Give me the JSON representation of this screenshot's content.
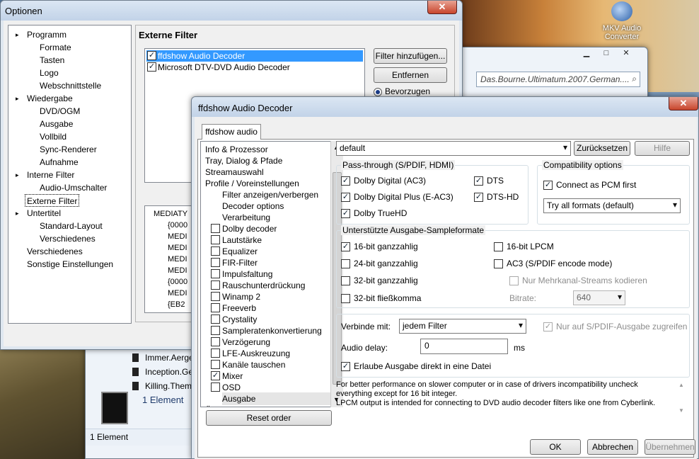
{
  "desktop": {
    "icon_label": "MKV Audio Converter"
  },
  "explorer": {
    "search_text": "Das.Bourne.Ultimatum.2007.German....",
    "files": [
      "Immer.Aerge",
      "Inception.Ge",
      "Killing.Them"
    ],
    "element_count": "1 Element",
    "status": "1 Element"
  },
  "optionen": {
    "title": "Optionen",
    "tree": [
      {
        "label": "Programm",
        "level": 0
      },
      {
        "label": "Formate",
        "level": 1
      },
      {
        "label": "Tasten",
        "level": 1
      },
      {
        "label": "Logo",
        "level": 1
      },
      {
        "label": "Webschnittstelle",
        "level": 1
      },
      {
        "label": "Wiedergabe",
        "level": 0
      },
      {
        "label": "DVD/OGM",
        "level": 1
      },
      {
        "label": "Ausgabe",
        "level": 1
      },
      {
        "label": "Vollbild",
        "level": 1
      },
      {
        "label": "Sync-Renderer",
        "level": 1
      },
      {
        "label": "Aufnahme",
        "level": 1
      },
      {
        "label": "Interne Filter",
        "level": 0
      },
      {
        "label": "Audio-Umschalter",
        "level": 1
      },
      {
        "label": "Externe Filter",
        "level": 0
      },
      {
        "label": "Untertitel",
        "level": 0
      },
      {
        "label": "Standard-Layout",
        "level": 1
      },
      {
        "label": "Verschiedenes",
        "level": 1
      },
      {
        "label": "Verschiedenes",
        "level": 0
      },
      {
        "label": "Sonstige Einstellungen",
        "level": 0
      }
    ],
    "panel_title": "Externe Filter",
    "filters": [
      "ffdshow Audio Decoder",
      "Microsoft DTV-DVD Audio Decoder"
    ],
    "add_button": "Filter hinzufügen...",
    "remove_button": "Entfernen",
    "prefer_label": "Bevorzugen",
    "second_tree": [
      "MEDIATY",
      "{0000",
      "MEDI",
      "MEDI",
      "MEDI",
      "MEDI",
      "{0000",
      "MEDI",
      "{EB2"
    ]
  },
  "ffdshow": {
    "title": "ffdshow Audio Decoder",
    "tab": "ffdshow audio",
    "left_items": [
      {
        "label": "Info & Prozessor",
        "indent": 0,
        "check": null
      },
      {
        "label": "Tray, Dialog & Pfade",
        "indent": 0,
        "check": null
      },
      {
        "label": "Streamauswahl",
        "indent": 0,
        "check": null
      },
      {
        "label": "Profile / Voreinstellungen",
        "indent": 0,
        "check": null
      },
      {
        "label": "Filter anzeigen/verbergen",
        "indent": 1,
        "check": null
      },
      {
        "label": "Decoder options",
        "indent": 1,
        "check": null
      },
      {
        "label": "Verarbeitung",
        "indent": 1,
        "check": null
      },
      {
        "label": "Dolby decoder",
        "indent": 1,
        "check": false
      },
      {
        "label": "Lautstärke",
        "indent": 1,
        "check": false
      },
      {
        "label": "Equalizer",
        "indent": 1,
        "check": false
      },
      {
        "label": "FIR-Filter",
        "indent": 1,
        "check": false
      },
      {
        "label": "Impulsfaltung",
        "indent": 1,
        "check": false
      },
      {
        "label": "Rauschunterdrückung",
        "indent": 1,
        "check": false
      },
      {
        "label": "Winamp 2",
        "indent": 1,
        "check": false
      },
      {
        "label": "Freeverb",
        "indent": 1,
        "check": false
      },
      {
        "label": "Crystality",
        "indent": 1,
        "check": false
      },
      {
        "label": "Sampleratenkonvertierung",
        "indent": 1,
        "check": false
      },
      {
        "label": "Verzögerung",
        "indent": 1,
        "check": false
      },
      {
        "label": "LFE-Auskreuzung",
        "indent": 1,
        "check": false
      },
      {
        "label": "Kanäle tauschen",
        "indent": 1,
        "check": false
      },
      {
        "label": "Mixer",
        "indent": 1,
        "check": true
      },
      {
        "label": "OSD",
        "indent": 1,
        "check": false
      },
      {
        "label": "Ausgabe",
        "indent": 1,
        "check": null
      },
      {
        "label": "Über",
        "indent": 0,
        "check": null
      }
    ],
    "reset_order": "Reset order",
    "preset": "default",
    "reset_button": "Zurücksetzen",
    "help_button": "Hilfe",
    "passthrough": {
      "title": "Pass-through (S/PDIF, HDMI)",
      "ac3": "Dolby Digital (AC3)",
      "eac3": "Dolby Digital Plus (E-AC3)",
      "truehd": "Dolby TrueHD",
      "dts": "DTS",
      "dtshd": "DTS-HD"
    },
    "compat": {
      "title": "Compatibility options",
      "pcm_first": "Connect as PCM first",
      "formats": "Try all formats (default)"
    },
    "formats": {
      "title": "Unterstützte Ausgabe-Sampleformate",
      "int16": "16-bit ganzzahlig",
      "int24": "24-bit ganzzahlig",
      "int32": "32-bit ganzzahlig",
      "float32": "32-bit fließkomma",
      "lpcm": "16-bit LPCM",
      "ac3": "AC3 (S/PDIF encode mode)",
      "multichannel": "Nur Mehrkanal-Streams kodieren",
      "bitrate_label": "Bitrate:",
      "bitrate": "640"
    },
    "connect": {
      "label": "Verbinde mit:",
      "value": "jedem Filter",
      "spdif_only": "Nur auf S/PDIF-Ausgabe zugreifen",
      "delay_label": "Audio delay:",
      "delay_value": "0",
      "delay_unit": "ms",
      "direct": "Erlaube Ausgabe direkt in eine Datei"
    },
    "info": "For better performance on slower computer or in case of drivers incompatibility uncheck everything except for 16 bit integer.\nLPCM output is intended for connecting to DVD audio decoder filters like one from Cyberlink.",
    "ok": "OK",
    "cancel": "Abbrechen",
    "apply": "Übernehmen"
  }
}
